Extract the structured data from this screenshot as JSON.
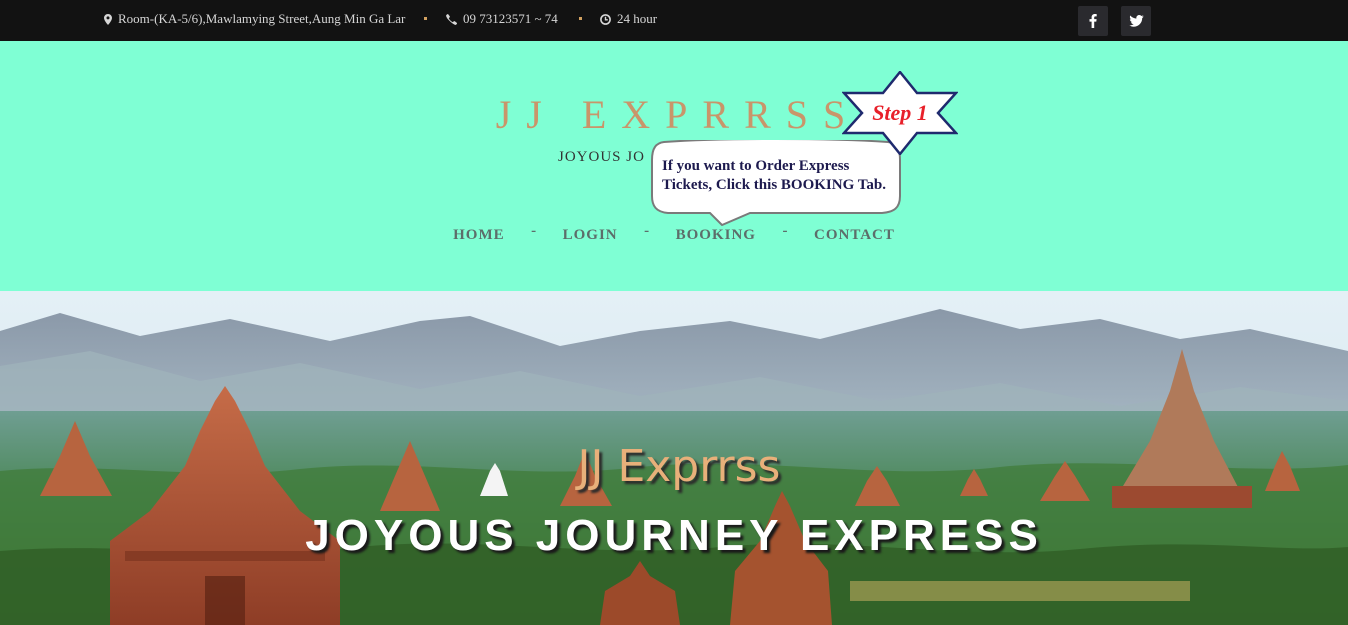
{
  "topbar": {
    "address": "Room-(KA-5/6),Mawlamying Street,Aung Min Ga Lar",
    "phone": "09 73123571 ~ 74",
    "hours": "24 hour",
    "social": [
      {
        "name": "facebook",
        "glyph": "f"
      },
      {
        "name": "twitter",
        "glyph": "twitter-bird"
      }
    ]
  },
  "header": {
    "title": "JJ EXPRRSS",
    "subtitle": "JOYOUS JO",
    "nav": [
      "HOME",
      "LOGIN",
      "BOOKING",
      "CONTACT"
    ],
    "nav_separator": "-"
  },
  "tutorial": {
    "step_label": "Step 1",
    "bubble_text": "If you want to Order Express Tickets, Click this BOOKING Tab."
  },
  "hero": {
    "title": "JJ Exprrss",
    "subtitle": "JOYOUS JOURNEY EXPRESS"
  },
  "colors": {
    "topbar_bg": "#121212",
    "header_bg": "#7fffd4",
    "title_color": "#c9956a",
    "step_red": "#e8202a",
    "bubble_text": "#1d1a4e"
  }
}
